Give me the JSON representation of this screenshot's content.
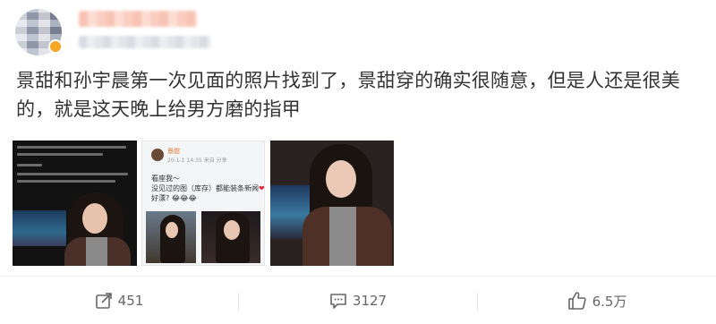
{
  "post": {
    "text": "景甜和孙宇晨第一次见面的照片找到了，景甜穿的确实很随意，但是人还是很美的，就是这天晚上给男方磨的指甲"
  },
  "embedded_post": {
    "author": "景甜",
    "meta": "20-1-1 14:35  来自 分享",
    "line1": "看座我～",
    "line2": "没见过的图（库存）都能装条新闻",
    "line3": "好漂? 😂😂😂"
  },
  "actions": {
    "repost_count": "451",
    "comment_count": "3127",
    "like_count": "6.5万"
  },
  "icons": {
    "repost": "repost-icon",
    "comment": "comment-icon",
    "like": "thumbs-up-icon"
  },
  "colors": {
    "text": "#333333",
    "muted": "#666666",
    "accent": "#e07b39",
    "heart": "#e0263c"
  }
}
